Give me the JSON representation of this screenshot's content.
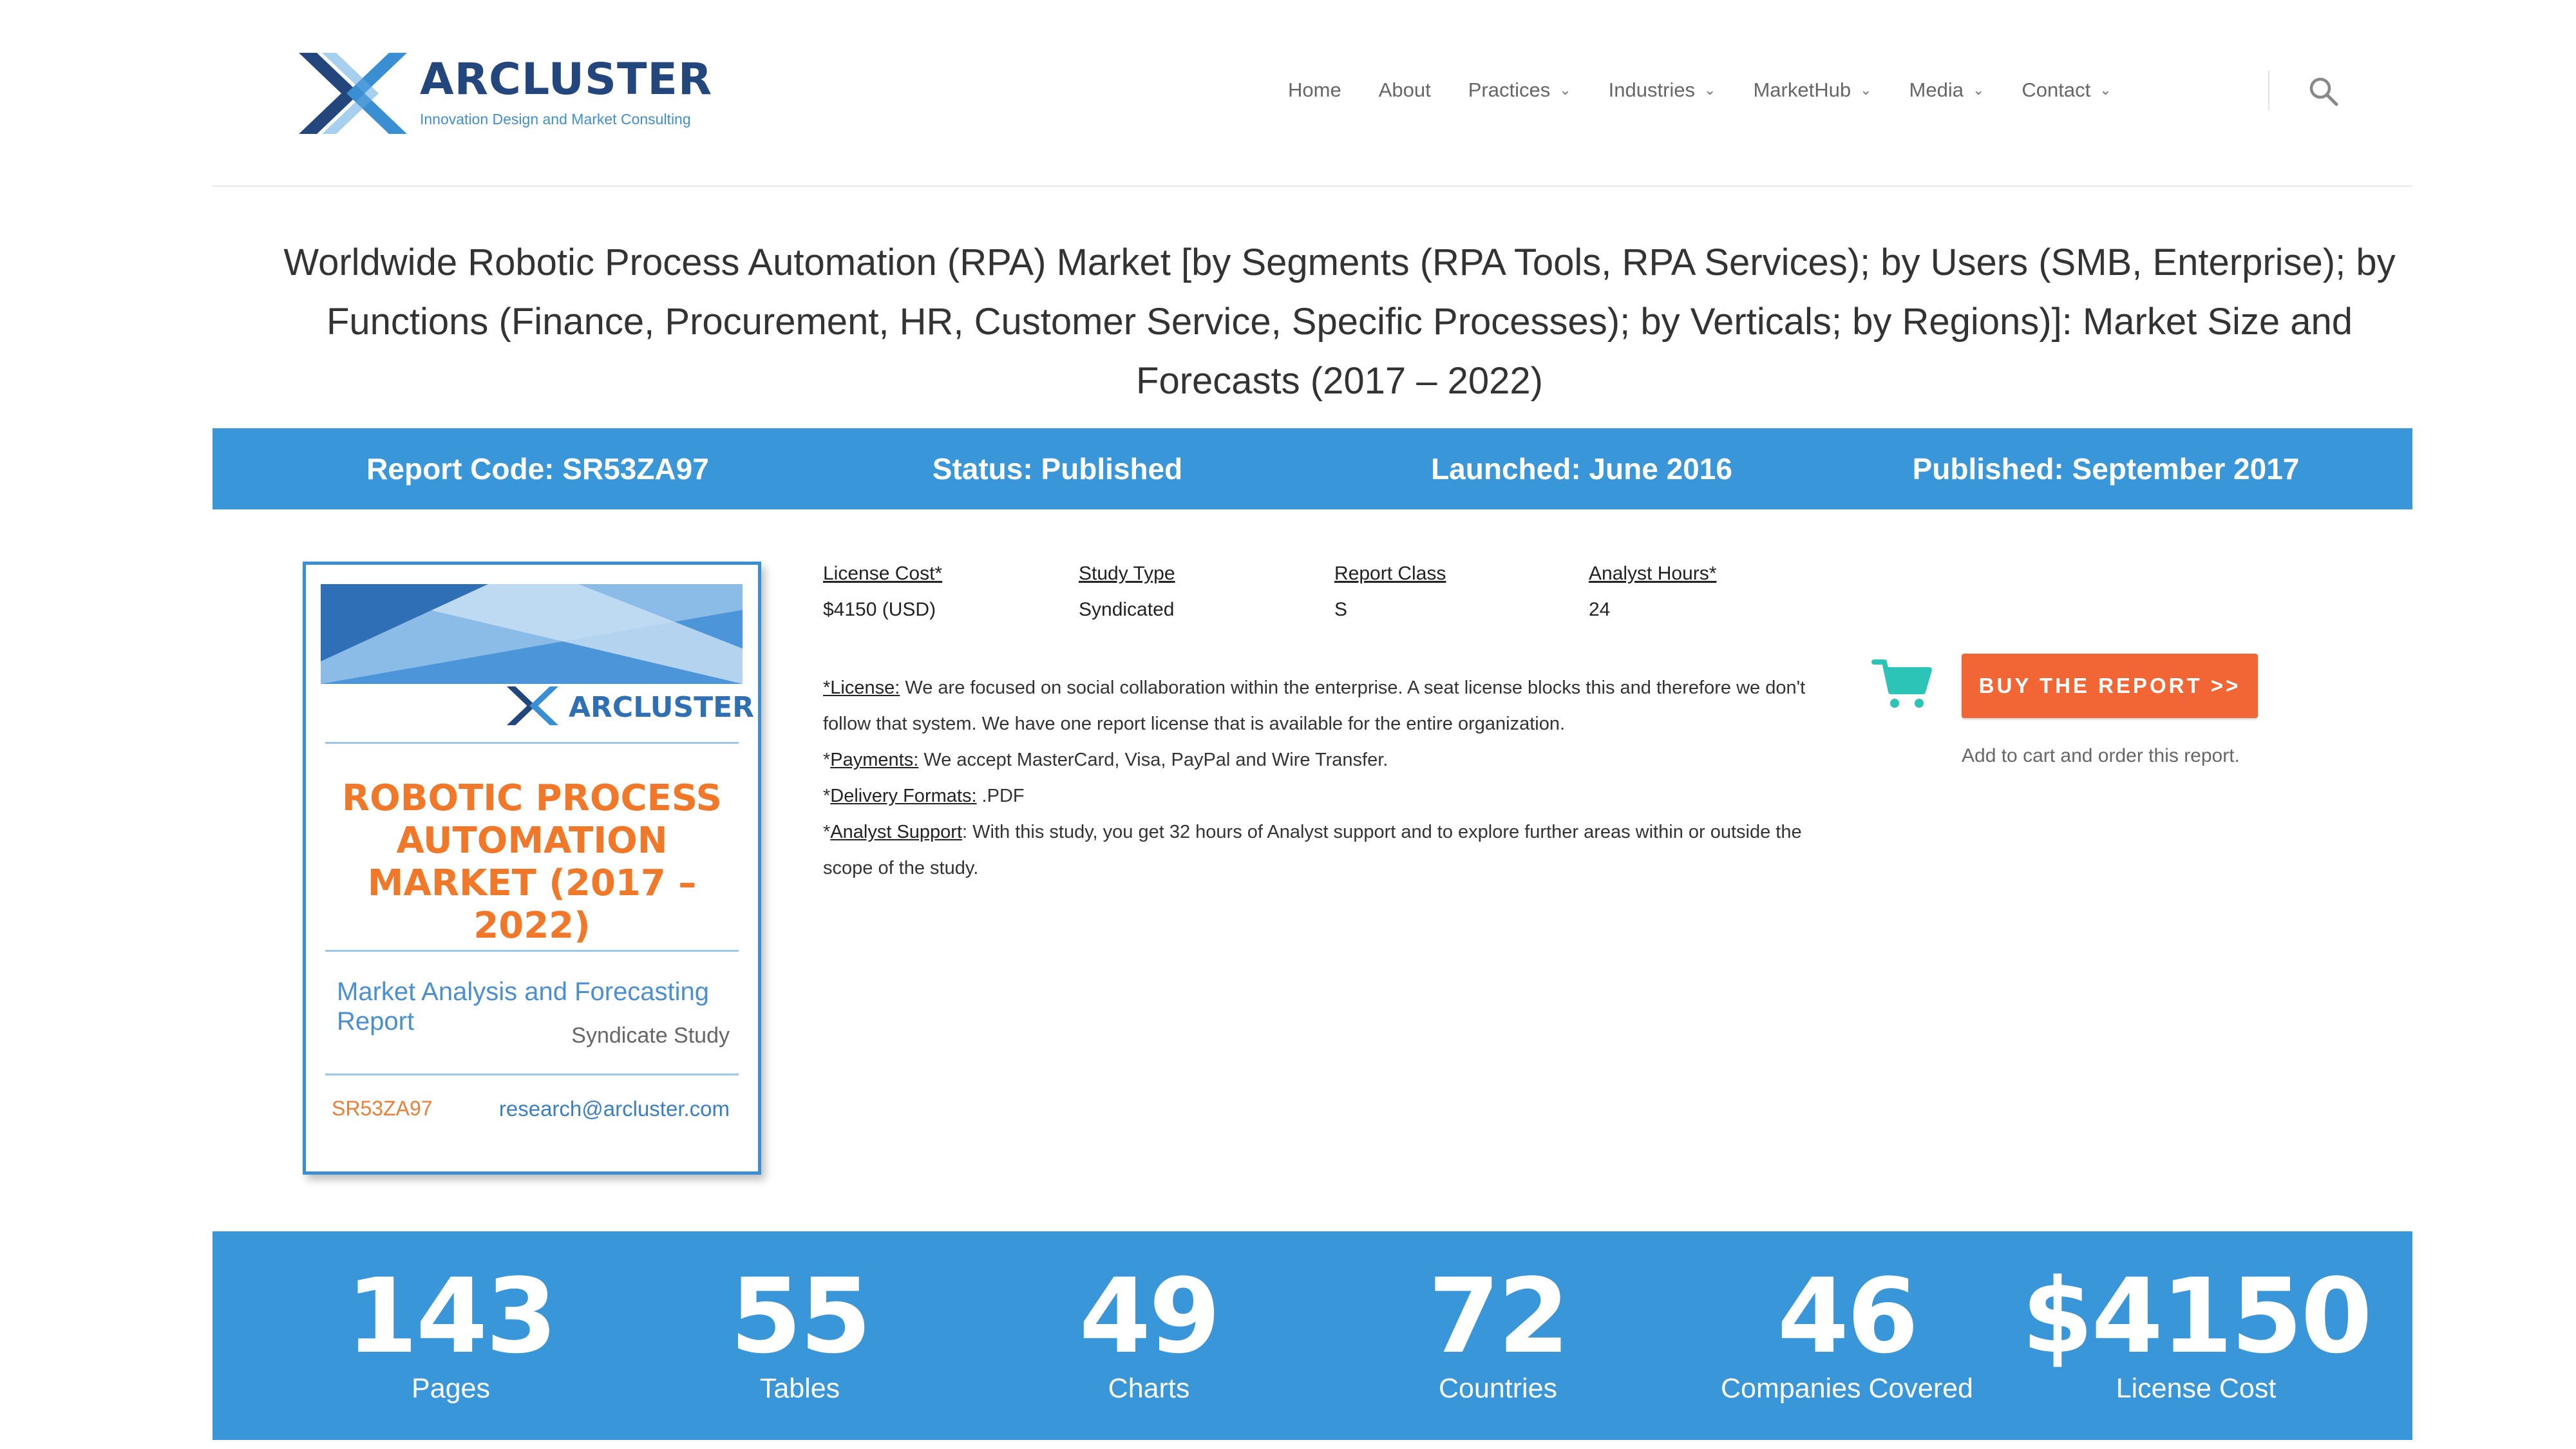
{
  "brand": {
    "name": "ARCLUSTER",
    "tagline": "Innovation Design and Market Consulting"
  },
  "nav": {
    "items": [
      {
        "label": "Home"
      },
      {
        "label": "About"
      },
      {
        "label": "Practices"
      },
      {
        "label": "Industries"
      },
      {
        "label": "MarketHub"
      },
      {
        "label": "Media"
      },
      {
        "label": "Contact"
      }
    ],
    "search_icon": "search-icon",
    "chevron_icon": "chevron-down-icon"
  },
  "title": "Worldwide Robotic Process Automation (RPA) Market [by Segments (RPA Tools, RPA Services); by Users (SMB, Enterprise); by Functions (Finance, Procurement, HR, Customer Service, Specific Processes); by Verticals; by Regions)]: Market Size and Forecasts (2017 – 2022)",
  "info_bar": {
    "report_code": "Report Code: SR53ZA97",
    "status": "Status: Published",
    "launched": "Launched: June 2016",
    "published": "Published: September 2017"
  },
  "cover": {
    "brand": "ARCLUSTER",
    "title_line1": "ROBOTIC PROCESS",
    "title_line2": "AUTOMATION",
    "title_line3": "MARKET (2017 – 2022)",
    "subtitle": "Market Analysis and Forecasting Report",
    "study": "Syndicate Study",
    "code": "SR53ZA97",
    "email": "research@arcluster.com",
    "colors": {
      "accent": "#f07828",
      "blue": "#3a8fd3"
    }
  },
  "details": {
    "license_cost_label": "License Cost*",
    "license_cost_value": "$4150 (USD)",
    "study_type_label": "Study Type",
    "study_type_value": "Syndicated",
    "report_class_label": "Report Class",
    "report_class_value": "S",
    "analyst_hours_label": "Analyst Hours*",
    "analyst_hours_value": "24"
  },
  "notes": {
    "license_key": "*License:",
    "license_text": " We are focused on social collaboration within the enterprise. A seat license blocks this and therefore we don't follow that system. We have one report license that is available for the entire organization.",
    "payments_prefix": "*",
    "payments_key": "Payments:",
    "payments_text": " We accept MasterCard, Visa, PayPal and Wire Transfer.",
    "delivery_prefix": "*",
    "delivery_key": "Delivery Formats:",
    "delivery_text": " .PDF",
    "support_prefix": "*",
    "support_key": "Analyst Support",
    "support_text": ": With this study, you get 32 hours of Analyst support and to explore further areas within or outside the scope of the study."
  },
  "buy": {
    "button_label": "BUY THE REPORT >>",
    "caption": "Add to cart and order this report.",
    "cart_icon": "shopping-cart-icon",
    "cart_color": "#2bc4b6",
    "button_color": "#f26534"
  },
  "stats": [
    {
      "value": "143",
      "label": "Pages"
    },
    {
      "value": "55",
      "label": "Tables"
    },
    {
      "value": "49",
      "label": "Charts"
    },
    {
      "value": "72",
      "label": "Countries"
    },
    {
      "value": "46",
      "label": "Companies Covered"
    },
    {
      "value": "$4150",
      "label": "License Cost"
    }
  ],
  "colors": {
    "bar_blue": "#3896d9",
    "brand_navy": "#23477c"
  }
}
